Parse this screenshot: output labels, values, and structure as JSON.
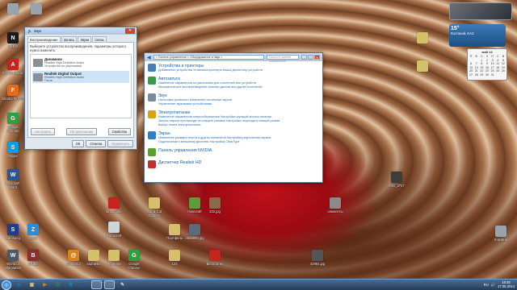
{
  "desktop": {
    "icons": [
      {
        "label": "",
        "glyph": "",
        "color": "#9aa3ad"
      },
      {
        "label": "",
        "glyph": "",
        "color": "#9aa3ad"
      },
      {
        "label": "NERO",
        "glyph": "N",
        "color": "#1b1b1b"
      },
      {
        "label": "",
        "glyph": "",
        "color": "#8aa0b8"
      },
      {
        "label": "Adobe Reader",
        "glyph": "A",
        "color": "#c5241f"
      },
      {
        "label": "",
        "glyph": "",
        "color": "#d4c06a"
      },
      {
        "label": "",
        "glyph": "",
        "color": "#d4c06a"
      },
      {
        "label": "Mozilla Firefox",
        "glyph": "F",
        "color": "#e66a1c"
      },
      {
        "label": "Google Chrome",
        "glyph": "G",
        "color": "#2f9e44"
      },
      {
        "label": "Skype",
        "glyph": "S",
        "color": "#0a9de8"
      },
      {
        "label": "Microsoft Word",
        "glyph": "W",
        "color": "#2a5699"
      },
      {
        "label": "",
        "glyph": "",
        "color": "#d4c06a"
      },
      {
        "label": "Samsung",
        "glyph": "S",
        "color": "#1f3e8c"
      },
      {
        "label": "Zona",
        "glyph": "Z",
        "color": "#2a8ed6"
      },
      {
        "label": "",
        "glyph": "",
        "color": "#d4c06a"
      },
      {
        "label": "World of Warplanes",
        "glyph": "W",
        "color": "#4b5a6b"
      },
      {
        "label": "ВКДЕ!",
        "glyph": "B",
        "color": "#8b2e2e"
      },
      {
        "label": "magnifico",
        "glyph": "@",
        "color": "#d8831c"
      },
      {
        "label": "картинки",
        "glyph": "",
        "color": "#d4c06a"
      },
      {
        "label": "Чернила",
        "glyph": "",
        "color": "#d4c06a"
      },
      {
        "label": "Google Chrome",
        "glyph": "G",
        "color": "#2f9e44"
      },
      {
        "label": "123",
        "glyph": "",
        "color": "#d4c06a"
      },
      {
        "label": "",
        "glyph": "",
        "color": "#d4c06a"
      },
      {
        "label": "Бесплатно",
        "glyph": "",
        "color": "#c5241f"
      },
      {
        "label": "",
        "glyph": "",
        "color": "#d4c06a"
      },
      {
        "label": "",
        "glyph": "",
        "color": "#555555"
      },
      {
        "label": "ramazanfix",
        "glyph": "",
        "color": "#c5241f"
      },
      {
        "label": "",
        "glyph": "",
        "color": "#d4c06a"
      },
      {
        "label": "Robocraft",
        "glyph": "",
        "color": "#d0d4da"
      },
      {
        "label": "Cut & Cut Games",
        "glyph": "",
        "color": "#d4c06a"
      },
      {
        "label": "minecraft",
        "glyph": "",
        "color": "#5a9e3c"
      },
      {
        "label": "222.jpg",
        "glyph": "",
        "color": "#8a6a4a"
      },
      {
        "label": "Портфель",
        "glyph": "",
        "color": "#d4c06a"
      },
      {
        "label": "2555990.jpg",
        "glyph": "",
        "color": "#5a6a7a"
      },
      {
        "label": "42984.jpg",
        "glyph": "",
        "color": "#555555"
      },
      {
        "label": "IMG_3747",
        "glyph": "",
        "color": "#3d3d3d"
      },
      {
        "label": "самолеты",
        "glyph": "",
        "color": "#8a8a8a"
      },
      {
        "label": "Корзина",
        "glyph": "",
        "color": "#9aa3ad"
      }
    ]
  },
  "sound_dialog": {
    "title": "Звук",
    "tabs": [
      "Воспроизведение",
      "Запись",
      "Звуки",
      "Связь"
    ],
    "hint": "Выберите устройство воспроизведения, параметры которого нужно изменить:",
    "devices": [
      {
        "name": "Динамики",
        "driver": "Realtek High Definition Audio",
        "state": "Устройство по умолчанию"
      },
      {
        "name": "Realtek Digital Output",
        "driver": "Realtek High Definition Audio",
        "state": "Готов"
      }
    ],
    "configure": "Настроить",
    "default": "По умолчанию",
    "properties": "Свойства",
    "ok": "ОК",
    "cancel": "Отмена",
    "apply": "Применить"
  },
  "control_panel": {
    "address": "« Панель управления » Оборудование и звук »",
    "search_placeholder": "Поиск в панели управления",
    "categories": [
      {
        "title": "Устройства и принтеры",
        "color": "#4a7db8",
        "links": "Добавление устройства   Установка принтера   Мышь   Диспетчер устройств"
      },
      {
        "title": "Автозапуск",
        "color": "#3a9a4a",
        "links": "Изменение параметров по умолчанию для носителей или устройств\nАвтоматическое воспроизведение компакт-дисков или других носителей"
      },
      {
        "title": "Звук",
        "color": "#7a8a9a",
        "links": "Настройка громкости   Изменение системных звуков\nУправление звуковыми устройствами"
      },
      {
        "title": "Электропитание",
        "color": "#d6a21c",
        "links": "Изменение параметров энергосбережения   Настройка функций кнопок питания\nЗапрос пароля при выходе из спящего режима   Настройка перехода в спящий режим\nВыбор плана электропитания"
      },
      {
        "title": "Экран",
        "color": "#2f7fc8",
        "links": "Изменение размера текста и других элементов   Настройка разрешения экрана\nПодключение к внешнему дисплею   Настройка ClearType"
      },
      {
        "title": "Панель управления NVIDIA",
        "color": "#5aa02c",
        "links": ""
      },
      {
        "title": "Диспетчер Realtek HD",
        "color": "#c03030",
        "links": ""
      }
    ]
  },
  "gadgets": {
    "weather": {
      "temp": "15°",
      "place": "Костанай, KAZ"
    },
    "calendar": {
      "month": "май 14",
      "days": [
        "П",
        "В",
        "С",
        "Ч",
        "П",
        "С",
        "В",
        "",
        "",
        "1",
        "2",
        "3",
        "4",
        "5",
        "6",
        "7",
        "8",
        "9",
        "10",
        "11",
        "12",
        "13",
        "14",
        "15",
        "16",
        "17",
        "18",
        "19",
        "20",
        "21",
        "22",
        "23",
        "24",
        "25",
        "26",
        "27",
        "28",
        "29",
        "30",
        "31"
      ]
    }
  },
  "taskbar": {
    "apps": [
      {
        "name": "ie",
        "glyph": "e",
        "color": "#1e7fd0"
      },
      {
        "name": "explorer",
        "glyph": "▣",
        "color": "#d4c06a"
      },
      {
        "name": "media",
        "glyph": "▶",
        "color": "#e07a1c"
      },
      {
        "name": "chrome",
        "glyph": "G",
        "color": "#2f9e44"
      },
      {
        "name": "skype",
        "glyph": "S",
        "color": "#0a9de8"
      },
      {
        "name": "word",
        "glyph": "W",
        "color": "#2a5699"
      },
      {
        "name": "control-panel",
        "glyph": "◧",
        "color": "#4a7db8"
      },
      {
        "name": "sound",
        "glyph": "♪",
        "color": "#7a8a9a"
      },
      {
        "name": "paint",
        "glyph": "✎",
        "color": "#d0d4da"
      }
    ],
    "lang": "RU",
    "time": "18:46",
    "date": "17.05.2014"
  }
}
